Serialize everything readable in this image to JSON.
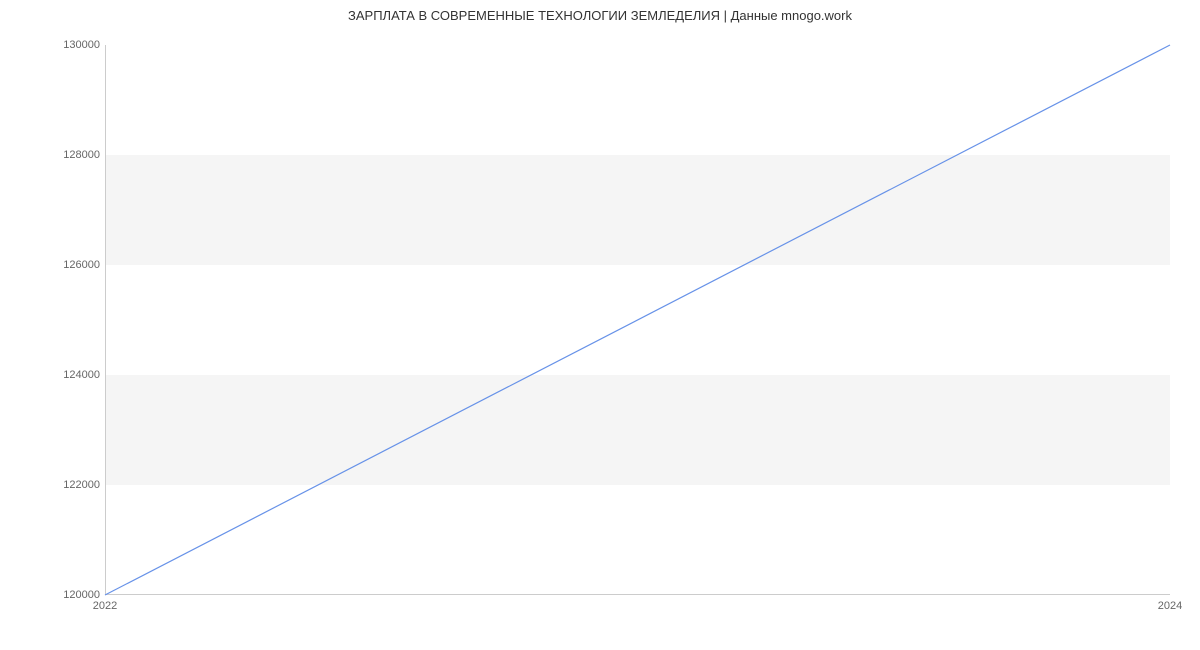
{
  "chart_data": {
    "type": "line",
    "title": "ЗАРПЛАТА В  СОВРЕМЕННЫЕ ТЕХНОЛОГИИ ЗЕМЛЕДЕЛИЯ | Данные mnogo.work",
    "x": [
      2022,
      2024
    ],
    "values": [
      120000,
      130000
    ],
    "xlabel": "",
    "ylabel": "",
    "xlim": [
      2022,
      2024
    ],
    "ylim": [
      120000,
      130000
    ],
    "x_ticks": [
      2022,
      2024
    ],
    "y_ticks": [
      120000,
      122000,
      124000,
      126000,
      128000,
      130000
    ],
    "bands": [
      {
        "from": 122000,
        "to": 124000
      },
      {
        "from": 126000,
        "to": 128000
      }
    ],
    "line_color": "#6792e8"
  }
}
